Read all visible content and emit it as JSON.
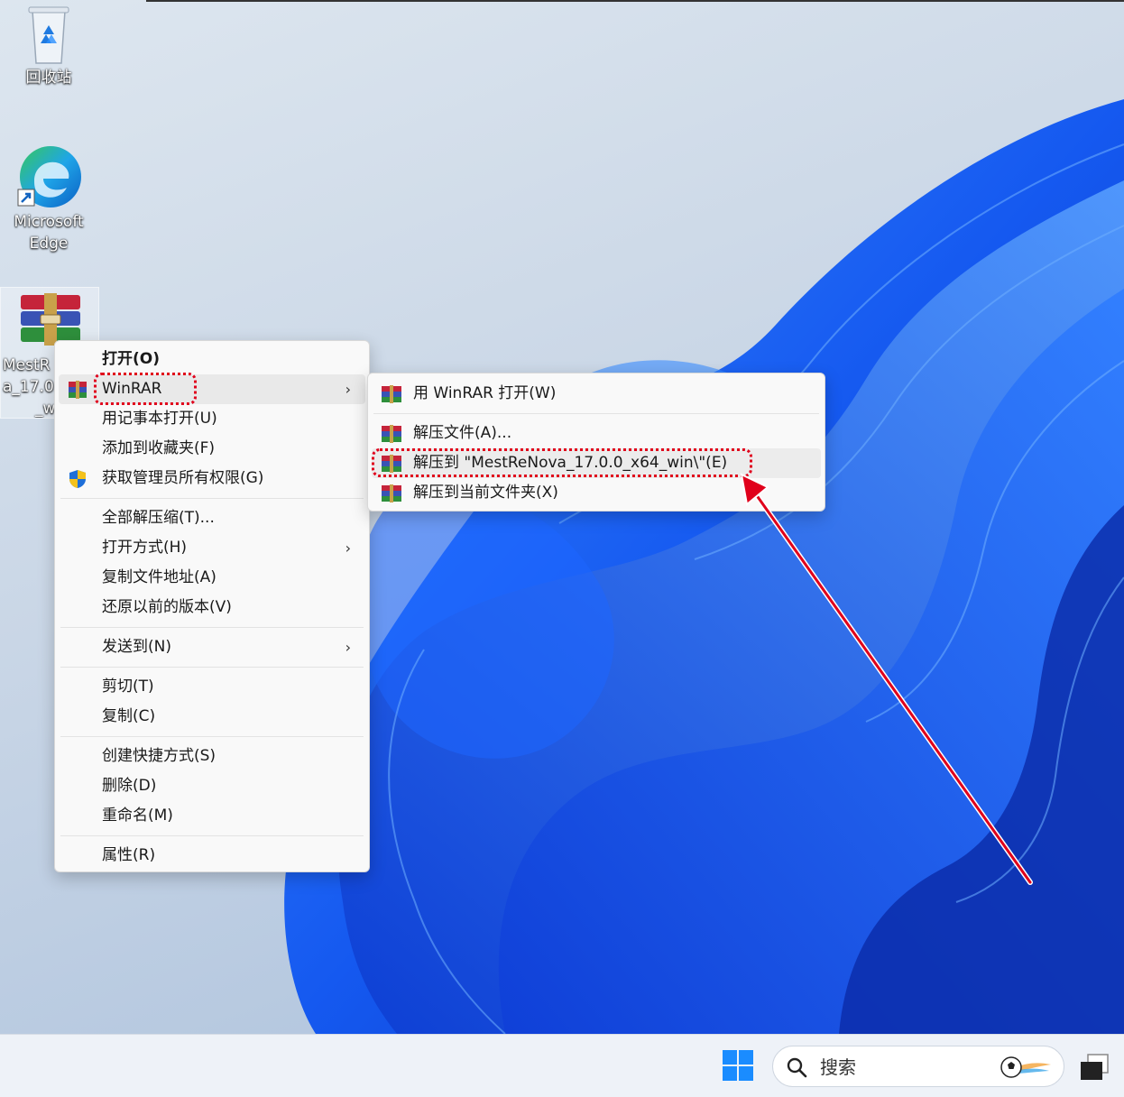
{
  "desktop": {
    "icons": [
      {
        "label": "回收站",
        "icon": "recycle-bin-icon"
      },
      {
        "label_line1": "Microsoft",
        "label_line2": "Edge",
        "icon": "edge-icon"
      },
      {
        "label_line1": "MestR",
        "label_line2": "a_17.0.",
        "label_line3": "_wi",
        "icon": "winrar-archive-icon"
      }
    ]
  },
  "context_menu": {
    "items": [
      {
        "label": "打开(O)"
      },
      {
        "label": "WinRAR"
      },
      {
        "label": "用记事本打开(U)"
      },
      {
        "label": "添加到收藏夹(F)"
      },
      {
        "label": "获取管理员所有权限(G)"
      },
      {
        "label": "全部解压缩(T)..."
      },
      {
        "label": "打开方式(H)"
      },
      {
        "label": "复制文件地址(A)"
      },
      {
        "label": "还原以前的版本(V)"
      },
      {
        "label": "发送到(N)"
      },
      {
        "label": "剪切(T)"
      },
      {
        "label": "复制(C)"
      },
      {
        "label": "创建快捷方式(S)"
      },
      {
        "label": "删除(D)"
      },
      {
        "label": "重命名(M)"
      },
      {
        "label": "属性(R)"
      }
    ],
    "chevron": "›"
  },
  "winrar_submenu": {
    "items": [
      {
        "label": "用 WinRAR 打开(W)"
      },
      {
        "label": "解压文件(A)..."
      },
      {
        "label": "解压到 \"MestReNova_17.0.0_x64_win\\\"(E)"
      },
      {
        "label": "解压到当前文件夹(X)"
      }
    ]
  },
  "taskbar": {
    "search_placeholder": "搜索"
  },
  "colors": {
    "highlight_red": "#e0001b",
    "wallpaper_blue": "#1a5cff"
  }
}
